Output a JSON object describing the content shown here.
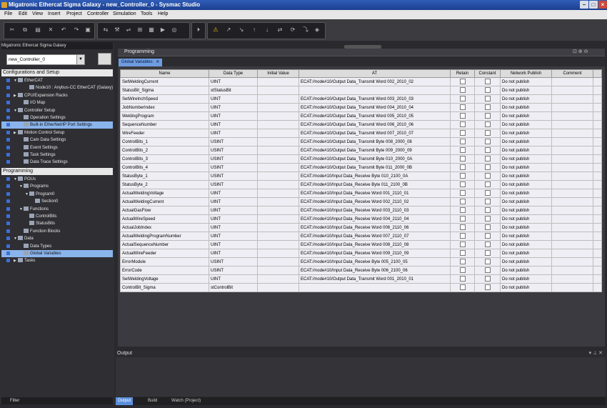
{
  "window": {
    "title": "Migatronic Ethercat Sigma Galaxy - new_Controller_0 - Sysmac Studio"
  },
  "menu": [
    "File",
    "Edit",
    "View",
    "Insert",
    "Project",
    "Controller",
    "Simulation",
    "Tools",
    "Help"
  ],
  "left_panel": {
    "title": "Migatronic Ethercat Sigma Galaxy",
    "controller": "new_Controller_0",
    "config_header": "Configurations and Setup",
    "programming_header": "Programming",
    "filter_label": "Filter",
    "config_tree": [
      {
        "label": "EtherCAT",
        "depth": 0,
        "toggle": "▼"
      },
      {
        "label": "Node10 : Anybus-CC EtherCAT (Galaxy)",
        "depth": 2,
        "toggle": ""
      },
      {
        "label": "CPU/Expansion Racks",
        "depth": 0,
        "toggle": "▶"
      },
      {
        "label": "I/O Map",
        "depth": 1,
        "toggle": ""
      },
      {
        "label": "Controller Setup",
        "depth": 0,
        "toggle": "▼"
      },
      {
        "label": "Operation Settings",
        "depth": 1,
        "toggle": ""
      },
      {
        "label": "Built-in EtherNet/IP Port Settings",
        "depth": 1,
        "toggle": "",
        "selected": true
      },
      {
        "label": "Motion Control Setup",
        "depth": 0,
        "toggle": "▶"
      },
      {
        "label": "Cam Data Settings",
        "depth": 1,
        "toggle": ""
      },
      {
        "label": "Event Settings",
        "depth": 1,
        "toggle": ""
      },
      {
        "label": "Task Settings",
        "depth": 1,
        "toggle": ""
      },
      {
        "label": "Data Trace Settings",
        "depth": 1,
        "toggle": ""
      }
    ],
    "prog_tree": [
      {
        "label": "POUs",
        "depth": 0,
        "toggle": "▼"
      },
      {
        "label": "Programs",
        "depth": 1,
        "toggle": "▼"
      },
      {
        "label": "Program0",
        "depth": 2,
        "toggle": "▼"
      },
      {
        "label": "Section0",
        "depth": 3,
        "toggle": ""
      },
      {
        "label": "Functions",
        "depth": 1,
        "toggle": "▼"
      },
      {
        "label": "ControlBits",
        "depth": 2,
        "toggle": ""
      },
      {
        "label": "StatusBits",
        "depth": 2,
        "toggle": ""
      },
      {
        "label": "Function Blocks",
        "depth": 1,
        "toggle": ""
      },
      {
        "label": "Data",
        "depth": 0,
        "toggle": "▼"
      },
      {
        "label": "Data Types",
        "depth": 1,
        "toggle": ""
      },
      {
        "label": "Global Variables",
        "depth": 1,
        "toggle": "",
        "selected": true
      },
      {
        "label": "Tasks",
        "depth": 0,
        "toggle": "▶"
      }
    ]
  },
  "main": {
    "panel_title": "Programming",
    "tab_label": "Global Variables",
    "columns": [
      "Name",
      "Data Type",
      "Initial Value",
      "AT",
      "Retain",
      "Constant",
      "Network Publish",
      "Comment"
    ],
    "rows": [
      [
        "SetWeldingCurrent",
        "UINT",
        "",
        "ECAT://node#10/Output Data_Transmit Word 002_2010_02",
        "Do not publish"
      ],
      [
        "StatusBit_Sigma",
        "stStatusBit",
        "",
        "",
        "Do not publish"
      ],
      [
        "SetWireInchSpeed",
        "UINT",
        "",
        "ECAT://node#10/Output Data_Transmit Word 003_2010_03",
        "Do not publish"
      ],
      [
        "JobNumberIndex",
        "UINT",
        "",
        "ECAT://node#10/Output Data_Transmit Word 004_2010_04",
        "Do not publish"
      ],
      [
        "WeldingProgram",
        "UINT",
        "",
        "ECAT://node#10/Output Data_Transmit Word 005_2010_05",
        "Do not publish"
      ],
      [
        "SequenceNumber",
        "UINT",
        "",
        "ECAT://node#10/Output Data_Transmit Word 006_2010_06",
        "Do not publish"
      ],
      [
        "WireFeeder",
        "UINT",
        "",
        "ECAT://node#10/Output Data_Transmit Word 007_2010_07",
        "Do not publish"
      ],
      [
        "ControlBits_1",
        "USINT",
        "",
        "ECAT://node#10/Output Data_Transmit Byte 008_2000_08",
        "Do not publish"
      ],
      [
        "ControlBits_2",
        "USINT",
        "",
        "ECAT://node#10/Output Data_Transmit Byte 009_2000_09",
        "Do not publish"
      ],
      [
        "ControlBits_3",
        "USINT",
        "",
        "ECAT://node#10/Output Data_Transmit Byte 010_2000_0A",
        "Do not publish"
      ],
      [
        "ControlBits_4",
        "USINT",
        "",
        "ECAT://node#10/Output Data_Transmit Byte 011_2000_0B",
        "Do not publish"
      ],
      [
        "StatusByte_1",
        "USINT",
        "",
        "ECAT://node#10/Input Data_Receive Byte 010_2100_0A",
        "Do not publish"
      ],
      [
        "StatusByte_2",
        "USINT",
        "",
        "ECAT://node#10/Input Data_Receive Byte 011_2100_0B",
        "Do not publish"
      ],
      [
        "ActualWeldingVoltage",
        "UINT",
        "",
        "ECAT://node#10/Input Data_Receive Word 001_2110_01",
        "Do not publish"
      ],
      [
        "ActualWeldingCurrent",
        "UINT",
        "",
        "ECAT://node#10/Input Data_Receive Word 002_2110_02",
        "Do not publish"
      ],
      [
        "ActualGasFlow",
        "UINT",
        "",
        "ECAT://node#10/Input Data_Receive Word 003_2110_03",
        "Do not publish"
      ],
      [
        "ActualWireSpeed",
        "UINT",
        "",
        "ECAT://node#10/Input Data_Receive Word 004_2110_04",
        "Do not publish"
      ],
      [
        "ActualJobIndex",
        "UINT",
        "",
        "ECAT://node#10/Input Data_Receive Word 006_2110_06",
        "Do not publish"
      ],
      [
        "ActualWeldingProgramNumber",
        "UINT",
        "",
        "ECAT://node#10/Input Data_Receive Word 007_2110_07",
        "Do not publish"
      ],
      [
        "ActualSequenceNumber",
        "UINT",
        "",
        "ECAT://node#10/Input Data_Receive Word 008_2110_08",
        "Do not publish"
      ],
      [
        "ActualWireFeeder",
        "UINT",
        "",
        "ECAT://node#10/Input Data_Receive Word 009_2110_09",
        "Do not publish"
      ],
      [
        "ErrorModule",
        "USINT",
        "",
        "ECAT://node#10/Input Data_Receive Byte 005_2100_05",
        "Do not publish"
      ],
      [
        "ErrorCode",
        "USINT",
        "",
        "ECAT://node#10/Input Data_Receive Byte 006_2100_06",
        "Do not publish"
      ],
      [
        "SetWeldingVoltage",
        "UINT",
        "",
        "ECAT://node#10/Output Data_Transmit Word 001_2010_01",
        "Do not publish"
      ],
      [
        "ControlBit_Sigma",
        "stControlBit",
        "",
        "",
        "Do not publish"
      ]
    ]
  },
  "output": {
    "title": "Output",
    "tabs": [
      "Output",
      "Build",
      "Watch (Project)"
    ]
  }
}
